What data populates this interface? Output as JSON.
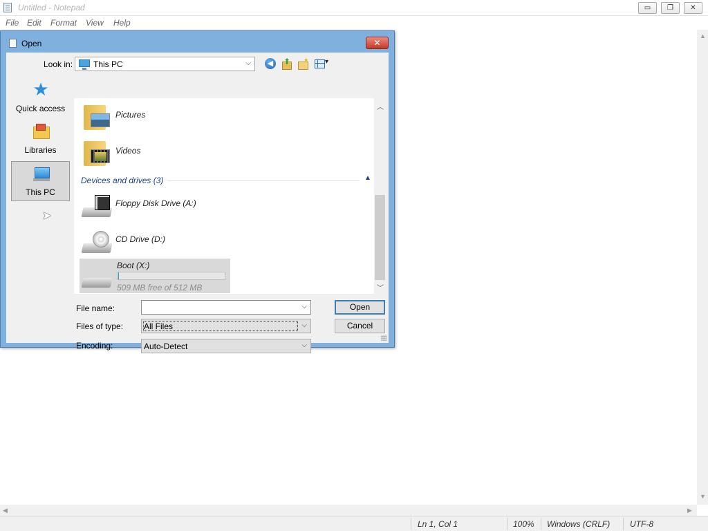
{
  "notepad": {
    "title": "Untitled - Notepad",
    "menu": [
      "File",
      "Edit",
      "Format",
      "View",
      "Help"
    ],
    "window_buttons": {
      "minimize": "▭",
      "restore": "❐",
      "close": "✕"
    },
    "status": {
      "position": "Ln 1, Col 1",
      "zoom": "100%",
      "line_ending": "Windows (CRLF)",
      "encoding": "UTF-8"
    }
  },
  "dialog": {
    "title": "Open",
    "close_glyph": "✕",
    "look_in_label": "Look in:",
    "look_in_value": "This PC",
    "places": [
      {
        "label": "Quick access",
        "icon": "star-icon"
      },
      {
        "label": "Libraries",
        "icon": "libraries-icon"
      },
      {
        "label": "This PC",
        "icon": "computer-icon",
        "selected": true
      }
    ],
    "folders": [
      {
        "label": "Pictures",
        "icon": "pictures-folder-icon"
      },
      {
        "label": "Videos",
        "icon": "videos-folder-icon"
      }
    ],
    "group_header": "Devices and drives (3)",
    "drives": [
      {
        "label": "Floppy Disk Drive (A:)",
        "icon": "floppy-drive-icon"
      },
      {
        "label": "CD Drive (D:)",
        "icon": "cd-drive-icon"
      }
    ],
    "boot_drive": {
      "label": "Boot (X:)",
      "free_text": "509 MB free of 512 MB",
      "used_fraction": 0.006
    },
    "file_name_label": "File name:",
    "file_name_value": "",
    "files_of_type_label": "Files of type:",
    "files_of_type_value": "All Files",
    "encoding_label": "Encoding:",
    "encoding_value": "Auto-Detect",
    "open_button": "Open",
    "cancel_button": "Cancel"
  },
  "colors": {
    "dialog_frame": "#7fb0de",
    "close_button": "#c53b29",
    "group_header_text": "#1e3e8f",
    "selection": "#d9d9d9"
  }
}
